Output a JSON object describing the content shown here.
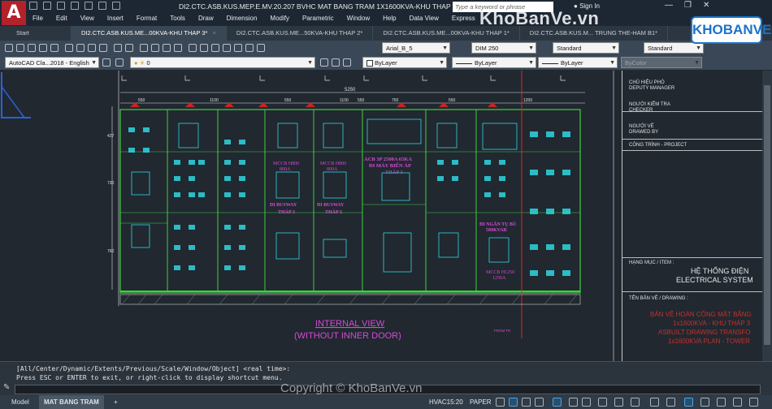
{
  "app": {
    "logo_letter": "A",
    "doc_title": "DI2.CTC.ASB.KUS.MEP.E.MV.20.207 BVHC MAT BANG TRAM 1X1600KVA-KHU THAP 3...",
    "search_placeholder": "Type a keyword or phrase",
    "sign_in": "Sign In"
  },
  "menu": [
    "File",
    "Edit",
    "View",
    "Insert",
    "Format",
    "Tools",
    "Draw",
    "Dimension",
    "Modify",
    "Parametric",
    "Window",
    "Help",
    "Data View",
    "Express"
  ],
  "tabs": [
    {
      "label": "Start"
    },
    {
      "label": "DI2.CTC.ASB.KUS.ME...00KVA-KHU THAP 3*"
    },
    {
      "label": "DI2.CTC.ASB.KUS.ME...50KVA-KHU THAP 2*"
    },
    {
      "label": "DI2.CTC.ASB.KUS.ME...00KVA-KHU THAP 1*"
    },
    {
      "label": "DI2.CTC.ASB.KUS.M... TRUNG THE-HAM B1*"
    }
  ],
  "toolbar": {
    "text_style": "Arial_B_5",
    "dim_style": "DIM 250",
    "table_style": "Standard",
    "mleader_style": "Standard",
    "workspace": "AutoCAD Cla...2018 - English",
    "layer": "0",
    "color": "ByLayer",
    "linetype": "ByLayer",
    "lineweight": "ByLayer",
    "plotstyle": "ByColor"
  },
  "drawing": {
    "dims_top": [
      "5250",
      "550",
      "1100",
      "550",
      "1100",
      "550",
      "750",
      "550",
      "1200"
    ],
    "dims_left": [
      "427",
      "730",
      "760"
    ],
    "panel_labels": [
      "MCCB H800",
      "800A",
      "MCCB H800",
      "800A",
      "ĐI BUSWAY",
      "THÁP 3",
      "ĐI BUSWAY",
      "THÁP 3",
      "ACB 3P 2500A 65KA",
      "ĐI MÁY BIẾN ÁP",
      "THÁP 3",
      "ĐI NGĂN TỤ BÙ",
      "500KVAR",
      "MCCB H1250",
      "1250A"
    ],
    "view_title": "INTERNAL VIEW",
    "view_subtitle": "(WITHOUT INNER DOOR)",
    "section_label": "FROM TR"
  },
  "title_block": {
    "chief_vn": "CHỦ HIỆU PHÓ",
    "chief_en": "DEPUTY MANAGER",
    "checker_vn": "NGƯỜI KIỂM TRA",
    "checker_en": "CHECKER",
    "drawer_vn": "NGƯỜI VẼ",
    "drawer_en": "DRAWED BY",
    "project": "CÔNG TRÌNH - PROJECT",
    "item_label": "HẠNG MỤC / ITEM :",
    "item_vn": "HỆ THỐNG ĐIỆN",
    "item_en": "ELECTRICAL SYSTEM",
    "drawing_label": "TÊN BẢN VẼ / DRAWING :",
    "drawing_l1": "BẢN VẼ HOÀN CÔNG MẶT BẰNG",
    "drawing_l2": "1x1600KVA - KHU THÁP 3",
    "drawing_l3": "ASBUILT DRAWING TRANSFO",
    "drawing_l4": "1x1600KVA PLAN - TOWER"
  },
  "command": {
    "line1": "[All/Center/Dynamic/Extents/Previous/Scale/Window/Object] <real time>:",
    "line2": "Press ESC or ENTER to exit, or right-click to display shortcut menu."
  },
  "status": {
    "tab_model": "Model",
    "tab_layout": "MAT BANG TRAM",
    "add": "+",
    "scale": "HVAC15:20",
    "space": "PAPER"
  },
  "watermarks": {
    "site": "KhoBanVe.vn",
    "badge": "KHOBANVE",
    "copyright": "Copyright © KhoBanVe.vn"
  },
  "colors": {
    "app_red": "#b3212b",
    "green_line": "#3fd13f",
    "magenta": "#d64ad6",
    "cyan": "#2fd6e0",
    "title_red": "#c6302a",
    "link_blue": "#4aa3e8"
  }
}
